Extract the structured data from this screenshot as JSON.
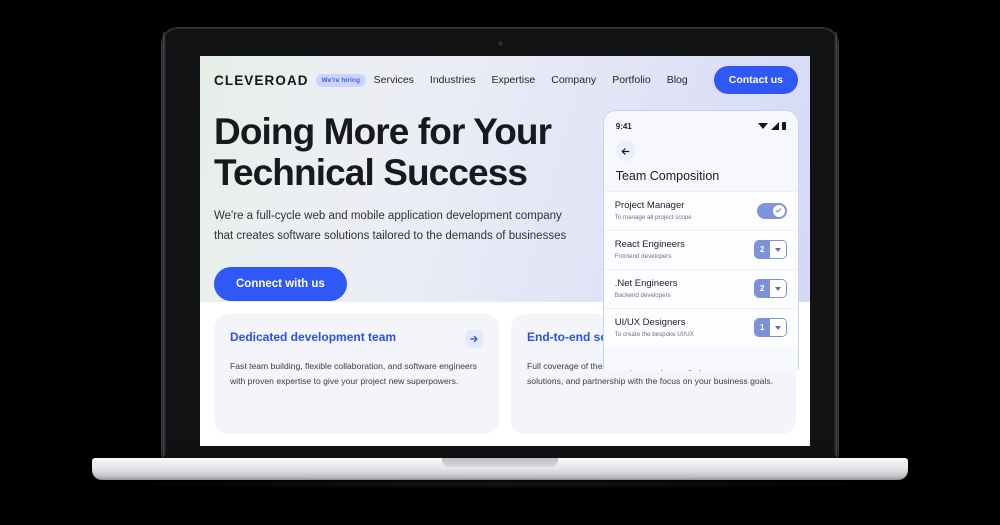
{
  "site": {
    "logo": "CLEVEROAD",
    "hiring_badge": "We're hiring",
    "nav": [
      {
        "label": "Services"
      },
      {
        "label": "Industries"
      },
      {
        "label": "Expertise"
      },
      {
        "label": "Company"
      },
      {
        "label": "Portfolio"
      },
      {
        "label": "Blog"
      }
    ],
    "contact_button": "Contact us"
  },
  "hero": {
    "title_line1": "Doing More for Your",
    "title_line2": "Technical Success",
    "subtitle_line1": "We're a full-cycle web and mobile application development company",
    "subtitle_line2": "that creates software solutions tailored to the demands of businesses",
    "cta": "Connect with us"
  },
  "phone": {
    "status_time": "9:41",
    "screen_title": "Team Composition",
    "rows": [
      {
        "title": "Project Manager",
        "subtitle": "To manage all project scope",
        "control": "toggle",
        "value": "on"
      },
      {
        "title": "React Engineers",
        "subtitle": "Frontend developers",
        "control": "stepper",
        "value": "2"
      },
      {
        "title": ".Net Engineers",
        "subtitle": "Backend developers",
        "control": "stepper",
        "value": "2"
      },
      {
        "title": "UI/UX Designers",
        "subtitle": "To create the bespoke UI/UX",
        "control": "stepper",
        "value": "1"
      }
    ]
  },
  "cards": [
    {
      "title": "Dedicated development team",
      "body": "Fast team building, flexible collaboration, and software engineers with proven expertise to give your project new superpowers."
    },
    {
      "title": "End-to-end software development",
      "body": "Full coverage of the development cycle, highly customized solutions, and partnership with the focus on your business goals."
    }
  ],
  "colors": {
    "brand_blue": "#2f58f6",
    "card_title_blue": "#2b51e8",
    "badge_bg": "#ccd4fb",
    "page_bg": "#000000"
  }
}
